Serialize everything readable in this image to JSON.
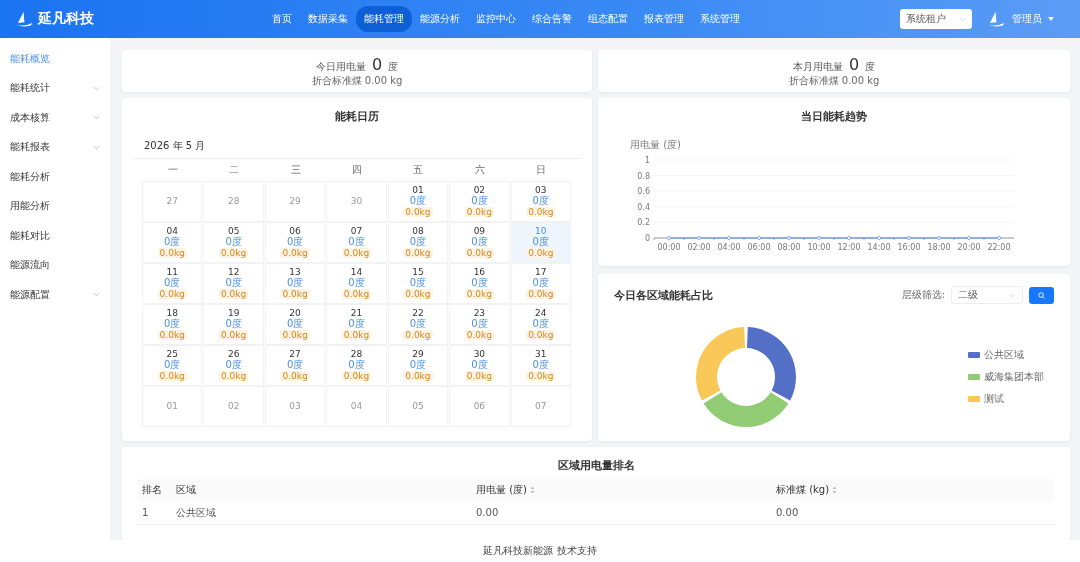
{
  "brand": "延凡科技",
  "nav": [
    {
      "label": "首页",
      "selected": false
    },
    {
      "label": "数据采集",
      "selected": false
    },
    {
      "label": "能耗管理",
      "selected": true
    },
    {
      "label": "能源分析",
      "selected": false
    },
    {
      "label": "监控中心",
      "selected": false
    },
    {
      "label": "综合告警",
      "selected": false
    },
    {
      "label": "组态配置",
      "selected": false
    },
    {
      "label": "报表管理",
      "selected": false
    },
    {
      "label": "系统管理",
      "selected": false
    }
  ],
  "tenant_select": {
    "value": "系统租户"
  },
  "user": {
    "name": "管理员"
  },
  "sidebar": {
    "items": [
      {
        "label": "能耗概览",
        "selected": true,
        "expandable": false
      },
      {
        "label": "能耗统计",
        "selected": false,
        "expandable": true
      },
      {
        "label": "成本核算",
        "selected": false,
        "expandable": true
      },
      {
        "label": "能耗报表",
        "selected": false,
        "expandable": true
      },
      {
        "label": "能耗分析",
        "selected": false,
        "expandable": false
      },
      {
        "label": "用能分析",
        "selected": false,
        "expandable": false
      },
      {
        "label": "能耗对比",
        "selected": false,
        "expandable": false
      },
      {
        "label": "能源流向",
        "selected": false,
        "expandable": false
      },
      {
        "label": "能源配置",
        "selected": false,
        "expandable": true
      }
    ]
  },
  "stats": [
    {
      "label": "今日用电量",
      "value": "0",
      "unit": "度",
      "sub": "折合标准煤 0.00 kg"
    },
    {
      "label": "本月用电量",
      "value": "0",
      "unit": "度",
      "sub": "折合标准煤 0.00 kg"
    }
  ],
  "calendar": {
    "title": "能耗日历",
    "month": "2026 年 5 月",
    "weekdays": [
      "一",
      "二",
      "三",
      "四",
      "五",
      "六",
      "日"
    ],
    "days": [
      {
        "day": "27",
        "in_month": false,
        "selected": false
      },
      {
        "day": "28",
        "in_month": false,
        "selected": false
      },
      {
        "day": "29",
        "in_month": false,
        "selected": false
      },
      {
        "day": "30",
        "in_month": false,
        "selected": false
      },
      {
        "day": "01",
        "in_month": true,
        "selected": false,
        "energy": "0度",
        "coal": "0.0kg"
      },
      {
        "day": "02",
        "in_month": true,
        "selected": false,
        "energy": "0度",
        "coal": "0.0kg"
      },
      {
        "day": "03",
        "in_month": true,
        "selected": false,
        "energy": "0度",
        "coal": "0.0kg"
      },
      {
        "day": "04",
        "in_month": true,
        "selected": false,
        "energy": "0度",
        "coal": "0.0kg"
      },
      {
        "day": "05",
        "in_month": true,
        "selected": false,
        "energy": "0度",
        "coal": "0.0kg"
      },
      {
        "day": "06",
        "in_month": true,
        "selected": false,
        "energy": "0度",
        "coal": "0.0kg"
      },
      {
        "day": "07",
        "in_month": true,
        "selected": false,
        "energy": "0度",
        "coal": "0.0kg"
      },
      {
        "day": "08",
        "in_month": true,
        "selected": false,
        "energy": "0度",
        "coal": "0.0kg"
      },
      {
        "day": "09",
        "in_month": true,
        "selected": false,
        "energy": "0度",
        "coal": "0.0kg"
      },
      {
        "day": "10",
        "in_month": true,
        "selected": true,
        "energy": "0度",
        "coal": "0.0kg"
      },
      {
        "day": "11",
        "in_month": true,
        "selected": false,
        "energy": "0度",
        "coal": "0.0kg"
      },
      {
        "day": "12",
        "in_month": true,
        "selected": false,
        "energy": "0度",
        "coal": "0.0kg"
      },
      {
        "day": "13",
        "in_month": true,
        "selected": false,
        "energy": "0度",
        "coal": "0.0kg"
      },
      {
        "day": "14",
        "in_month": true,
        "selected": false,
        "energy": "0度",
        "coal": "0.0kg"
      },
      {
        "day": "15",
        "in_month": true,
        "selected": false,
        "energy": "0度",
        "coal": "0.0kg"
      },
      {
        "day": "16",
        "in_month": true,
        "selected": false,
        "energy": "0度",
        "coal": "0.0kg"
      },
      {
        "day": "17",
        "in_month": true,
        "selected": false,
        "energy": "0度",
        "coal": "0.0kg"
      },
      {
        "day": "18",
        "in_month": true,
        "selected": false,
        "energy": "0度",
        "coal": "0.0kg"
      },
      {
        "day": "19",
        "in_month": true,
        "selected": false,
        "energy": "0度",
        "coal": "0.0kg"
      },
      {
        "day": "20",
        "in_month": true,
        "selected": false,
        "energy": "0度",
        "coal": "0.0kg"
      },
      {
        "day": "21",
        "in_month": true,
        "selected": false,
        "energy": "0度",
        "coal": "0.0kg"
      },
      {
        "day": "22",
        "in_month": true,
        "selected": false,
        "energy": "0度",
        "coal": "0.0kg"
      },
      {
        "day": "23",
        "in_month": true,
        "selected": false,
        "energy": "0度",
        "coal": "0.0kg"
      },
      {
        "day": "24",
        "in_month": true,
        "selected": false,
        "energy": "0度",
        "coal": "0.0kg"
      },
      {
        "day": "25",
        "in_month": true,
        "selected": false,
        "energy": "0度",
        "coal": "0.0kg"
      },
      {
        "day": "26",
        "in_month": true,
        "selected": false,
        "energy": "0度",
        "coal": "0.0kg"
      },
      {
        "day": "27",
        "in_month": true,
        "selected": false,
        "energy": "0度",
        "coal": "0.0kg"
      },
      {
        "day": "28",
        "in_month": true,
        "selected": false,
        "energy": "0度",
        "coal": "0.0kg"
      },
      {
        "day": "29",
        "in_month": true,
        "selected": false,
        "energy": "0度",
        "coal": "0.0kg"
      },
      {
        "day": "30",
        "in_month": true,
        "selected": false,
        "energy": "0度",
        "coal": "0.0kg"
      },
      {
        "day": "31",
        "in_month": true,
        "selected": false,
        "energy": "0度",
        "coal": "0.0kg"
      },
      {
        "day": "01",
        "in_month": false,
        "selected": false
      },
      {
        "day": "02",
        "in_month": false,
        "selected": false
      },
      {
        "day": "03",
        "in_month": false,
        "selected": false
      },
      {
        "day": "04",
        "in_month": false,
        "selected": false
      },
      {
        "day": "05",
        "in_month": false,
        "selected": false
      },
      {
        "day": "06",
        "in_month": false,
        "selected": false
      },
      {
        "day": "07",
        "in_month": false,
        "selected": false
      }
    ]
  },
  "trend": {
    "title": "当日能耗趋势",
    "chart_data": {
      "type": "line",
      "ylabel": "用电量 (度)",
      "categories": [
        "00:00",
        "02:00",
        "04:00",
        "06:00",
        "08:00",
        "10:00",
        "12:00",
        "14:00",
        "16:00",
        "18:00",
        "20:00",
        "22:00"
      ],
      "ylim": [
        0,
        1
      ],
      "yticks": [
        0,
        0.2,
        0.4,
        0.6,
        0.8,
        1
      ],
      "grid": true,
      "series": [
        {
          "color": "#5b8ff9",
          "marker": true,
          "values": [
            0,
            0,
            0,
            0,
            0,
            0,
            0,
            0,
            0,
            0,
            0,
            0
          ]
        }
      ]
    }
  },
  "share": {
    "title": "今日各区域能耗占比",
    "filter_label": "层级筛选:",
    "filter_value": "二级",
    "legend": [
      {
        "label": "公共区域",
        "color": "#5470c6"
      },
      {
        "label": "威海集团本部",
        "color": "#91cc75"
      },
      {
        "label": "测试",
        "color": "#fac858"
      }
    ]
  },
  "ranking": {
    "title": "区域用电量排名",
    "columns": [
      {
        "label": "排名",
        "sortable": false
      },
      {
        "label": "区域",
        "sortable": false
      },
      {
        "label": "用电量 (度)",
        "sortable": true
      },
      {
        "label": "标准煤 (kg)",
        "sortable": true
      }
    ],
    "rows": [
      [
        "1",
        "公共区域",
        "0.00",
        "0.00"
      ]
    ]
  },
  "footer": "延凡科技新能源 技术支持"
}
